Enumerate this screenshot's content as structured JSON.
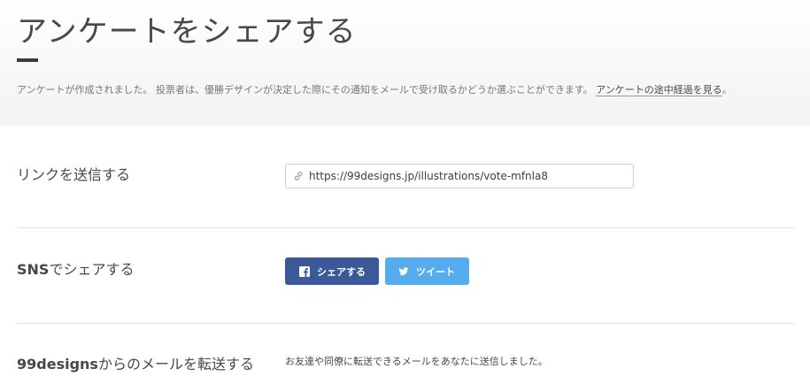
{
  "header": {
    "title": "アンケートをシェアする",
    "description": "アンケートが作成されました。 投票者は、優勝デザインが決定した際にその通知をメールで受け取るかどうか選ぶことができます。",
    "results_link": "アンケートの途中経過を見る",
    "results_link_suffix": "。"
  },
  "send_link": {
    "label": "リンクを送信する",
    "url": "https://99designs.jp/illustrations/vote-mfnla8"
  },
  "sns": {
    "label_bold": "SNS",
    "label_rest": "でシェアする",
    "facebook_label": "シェアする",
    "twitter_label": "ツイート"
  },
  "forward": {
    "label_bold": "99designs",
    "label_rest": "からのメールを転送する",
    "text": "お友達や同僚に転送できるメールをあなたに送信しました。"
  },
  "colors": {
    "facebook": "#3b5998",
    "twitter": "#55acee"
  },
  "icons": {
    "url_field": "link-icon",
    "facebook_button": "facebook-icon",
    "twitter_button": "twitter-bird-icon"
  }
}
